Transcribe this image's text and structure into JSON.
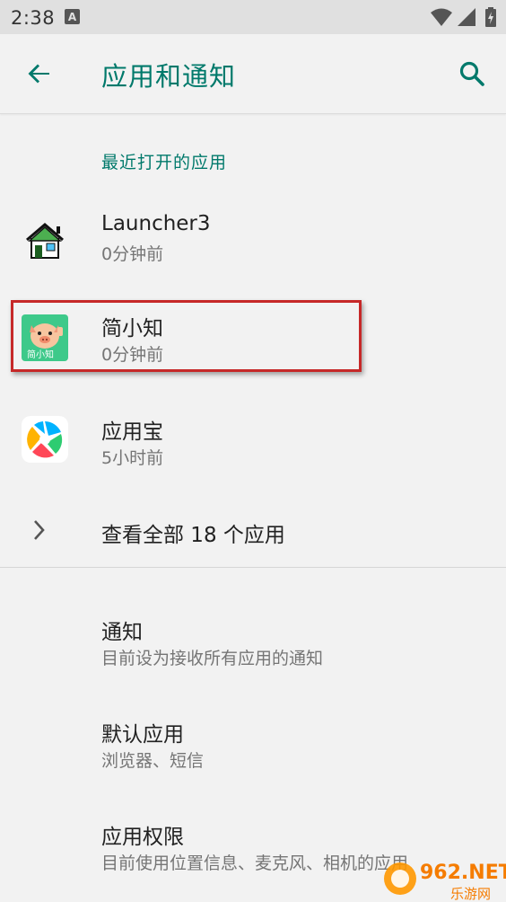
{
  "status_bar": {
    "time": "2:38",
    "notification_letter": "A"
  },
  "app_bar": {
    "title": "应用和通知",
    "back_icon": "arrow-left-icon",
    "search_icon": "search-icon",
    "accent_color": "#00796b"
  },
  "recent": {
    "header": "最近打开的应用",
    "apps": [
      {
        "name": "Launcher3",
        "time": "0分钟前",
        "icon": "house-icon"
      },
      {
        "name": "简小知",
        "time": "0分钟前",
        "icon": "pig-app-icon",
        "icon_text": "简小知"
      },
      {
        "name": "应用宝",
        "time": "5小时前",
        "icon": "yingyongbao-icon"
      }
    ],
    "see_all": "查看全部 18 个应用"
  },
  "settings": [
    {
      "title": "通知",
      "summary": "目前设为接收所有应用的通知"
    },
    {
      "title": "默认应用",
      "summary": "浏览器、短信"
    },
    {
      "title": "应用权限",
      "summary": "目前使用位置信息、麦克风、相机的应用"
    }
  ],
  "watermark": {
    "brand": "962.NET",
    "sub": "乐游网"
  }
}
